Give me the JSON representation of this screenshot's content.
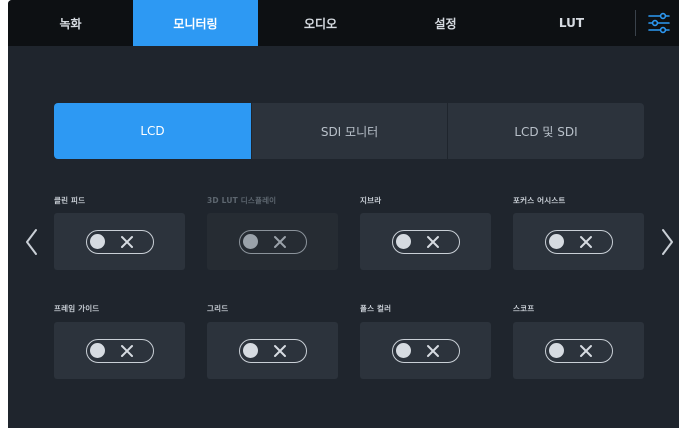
{
  "tabs": [
    {
      "label": "녹화",
      "active": false
    },
    {
      "label": "모니터링",
      "active": true
    },
    {
      "label": "오디오",
      "active": false
    },
    {
      "label": "설정",
      "active": false
    },
    {
      "label": "LUT",
      "active": false
    }
  ],
  "segments": [
    {
      "label": "LCD",
      "active": true
    },
    {
      "label": "SDI 모니터",
      "active": false
    },
    {
      "label": "LCD 및 SDI",
      "active": false
    }
  ],
  "options": [
    {
      "label": "클린 피드",
      "state": "off",
      "enabled": true
    },
    {
      "label": "3D LUT 디스플레이",
      "state": "off",
      "enabled": false
    },
    {
      "label": "지브라",
      "state": "off",
      "enabled": true
    },
    {
      "label": "포커스 어시스트",
      "state": "off",
      "enabled": true
    },
    {
      "label": "프레임 가이드",
      "state": "off",
      "enabled": true
    },
    {
      "label": "그리드",
      "state": "off",
      "enabled": true
    },
    {
      "label": "폴스 컬러",
      "state": "off",
      "enabled": true
    },
    {
      "label": "스코프",
      "state": "off",
      "enabled": true
    }
  ],
  "icons": {
    "settings": "sliders-icon",
    "prev": "chevron-left-icon",
    "next": "chevron-right-icon",
    "toggle_off": "close-icon"
  },
  "colors": {
    "accent": "#2d99f3",
    "background": "#1f252d",
    "tabbar": "#0d1013",
    "card": "#2c333c"
  }
}
